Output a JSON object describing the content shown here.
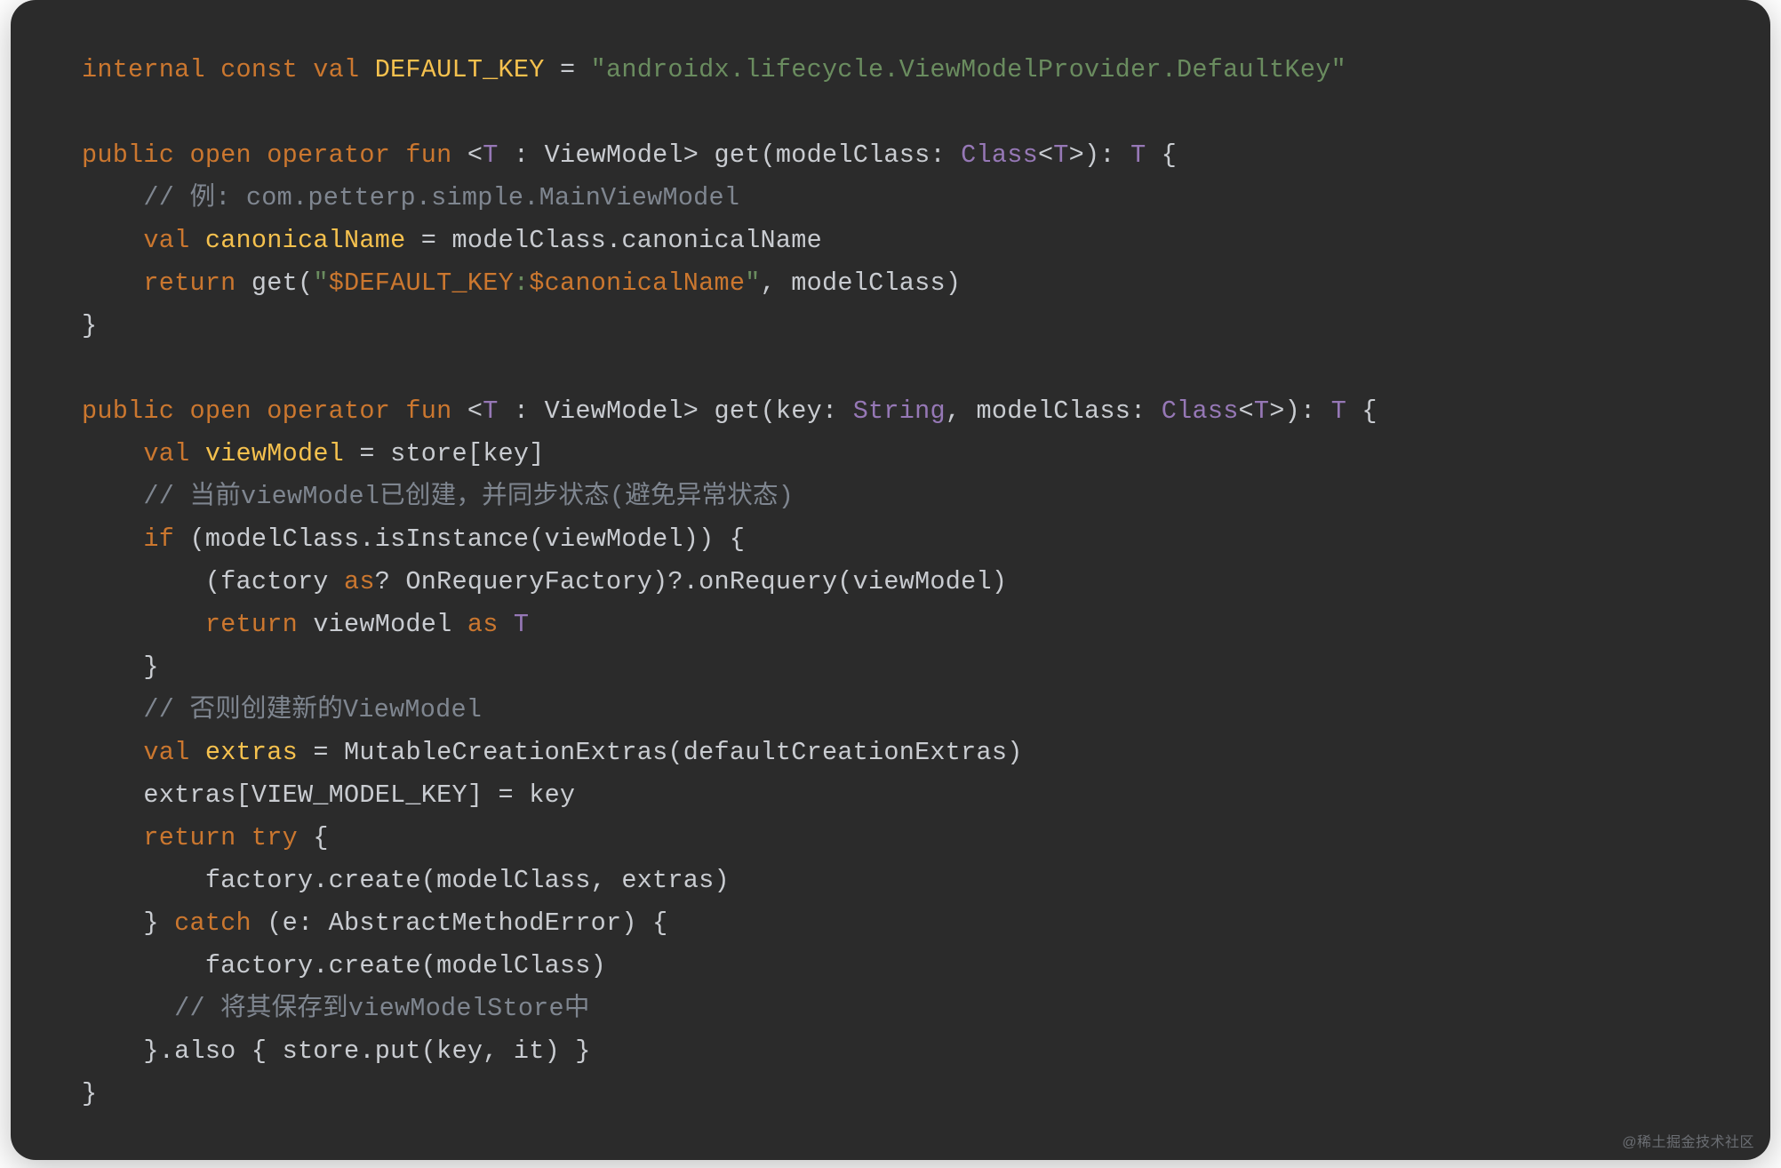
{
  "colors": {
    "bg": "#2b2b2b",
    "keyword": "#cb772f",
    "name": "#f5c14e",
    "string": "#6a8c5f",
    "comment": "#7f8690",
    "type": "#9678b6",
    "default": "#c9ccd1"
  },
  "watermark": "@稀土掘金技术社区",
  "code": {
    "lines": [
      [
        {
          "t": "internal const val ",
          "c": "kw"
        },
        {
          "t": "DEFAULT_KEY",
          "c": "name"
        },
        {
          "t": " = ",
          "c": "punc"
        },
        {
          "t": "\"androidx.lifecycle.ViewModelProvider.DefaultKey\"",
          "c": "str"
        }
      ],
      [],
      [
        {
          "t": "public open operator fun ",
          "c": "kw"
        },
        {
          "t": "<",
          "c": "punc"
        },
        {
          "t": "T",
          "c": "type"
        },
        {
          "t": " : ",
          "c": "punc"
        },
        {
          "t": "ViewModel",
          "c": "fn"
        },
        {
          "t": "> ",
          "c": "punc"
        },
        {
          "t": "get",
          "c": "fn"
        },
        {
          "t": "(modelClass: ",
          "c": "punc"
        },
        {
          "t": "Class",
          "c": "type"
        },
        {
          "t": "<",
          "c": "punc"
        },
        {
          "t": "T",
          "c": "type"
        },
        {
          "t": ">): ",
          "c": "punc"
        },
        {
          "t": "T",
          "c": "type"
        },
        {
          "t": " {",
          "c": "punc"
        }
      ],
      [
        {
          "t": "    ",
          "c": "punc"
        },
        {
          "t": "// 例: com.petterp.simple.MainViewModel",
          "c": "cmt"
        }
      ],
      [
        {
          "t": "    ",
          "c": "punc"
        },
        {
          "t": "val ",
          "c": "kw"
        },
        {
          "t": "canonicalName",
          "c": "name"
        },
        {
          "t": " = modelClass.canonicalName",
          "c": "punc"
        }
      ],
      [
        {
          "t": "    ",
          "c": "punc"
        },
        {
          "t": "return ",
          "c": "kw"
        },
        {
          "t": "get(",
          "c": "punc"
        },
        {
          "t": "\"",
          "c": "str"
        },
        {
          "t": "$DEFAULT_KEY",
          "c": "kw"
        },
        {
          "t": ":",
          "c": "str"
        },
        {
          "t": "$canonicalName",
          "c": "kw"
        },
        {
          "t": "\"",
          "c": "str"
        },
        {
          "t": ", modelClass)",
          "c": "punc"
        }
      ],
      [
        {
          "t": "}",
          "c": "punc"
        }
      ],
      [],
      [
        {
          "t": "public open operator fun ",
          "c": "kw"
        },
        {
          "t": "<",
          "c": "punc"
        },
        {
          "t": "T",
          "c": "type"
        },
        {
          "t": " : ",
          "c": "punc"
        },
        {
          "t": "ViewModel",
          "c": "fn"
        },
        {
          "t": "> ",
          "c": "punc"
        },
        {
          "t": "get",
          "c": "fn"
        },
        {
          "t": "(key: ",
          "c": "punc"
        },
        {
          "t": "String",
          "c": "type"
        },
        {
          "t": ", modelClass: ",
          "c": "punc"
        },
        {
          "t": "Class",
          "c": "type"
        },
        {
          "t": "<",
          "c": "punc"
        },
        {
          "t": "T",
          "c": "type"
        },
        {
          "t": ">): ",
          "c": "punc"
        },
        {
          "t": "T",
          "c": "type"
        },
        {
          "t": " {",
          "c": "punc"
        }
      ],
      [
        {
          "t": "    ",
          "c": "punc"
        },
        {
          "t": "val ",
          "c": "kw"
        },
        {
          "t": "viewModel",
          "c": "name"
        },
        {
          "t": " = store[key]",
          "c": "punc"
        }
      ],
      [
        {
          "t": "    ",
          "c": "punc"
        },
        {
          "t": "// 当前viewModel已创建，并同步状态(避免异常状态)",
          "c": "cmt"
        }
      ],
      [
        {
          "t": "    ",
          "c": "punc"
        },
        {
          "t": "if ",
          "c": "kw"
        },
        {
          "t": "(modelClass.isInstance(viewModel)) {",
          "c": "punc"
        }
      ],
      [
        {
          "t": "        (factory ",
          "c": "punc"
        },
        {
          "t": "as",
          "c": "kw"
        },
        {
          "t": "? OnRequeryFactory)?.onRequery(viewModel)",
          "c": "punc"
        }
      ],
      [
        {
          "t": "        ",
          "c": "punc"
        },
        {
          "t": "return ",
          "c": "kw"
        },
        {
          "t": "viewModel ",
          "c": "punc"
        },
        {
          "t": "as ",
          "c": "kw"
        },
        {
          "t": "T",
          "c": "type"
        }
      ],
      [
        {
          "t": "    }",
          "c": "punc"
        }
      ],
      [
        {
          "t": "    ",
          "c": "punc"
        },
        {
          "t": "// 否则创建新的ViewModel",
          "c": "cmt"
        }
      ],
      [
        {
          "t": "    ",
          "c": "punc"
        },
        {
          "t": "val ",
          "c": "kw"
        },
        {
          "t": "extras",
          "c": "name"
        },
        {
          "t": " = MutableCreationExtras(defaultCreationExtras)",
          "c": "punc"
        }
      ],
      [
        {
          "t": "    extras[VIEW_MODEL_KEY] = key",
          "c": "punc"
        }
      ],
      [
        {
          "t": "    ",
          "c": "punc"
        },
        {
          "t": "return try ",
          "c": "kw"
        },
        {
          "t": "{",
          "c": "punc"
        }
      ],
      [
        {
          "t": "        factory.create(modelClass, extras)",
          "c": "punc"
        }
      ],
      [
        {
          "t": "    } ",
          "c": "punc"
        },
        {
          "t": "catch ",
          "c": "kw"
        },
        {
          "t": "(e: AbstractMethodError) {",
          "c": "punc"
        }
      ],
      [
        {
          "t": "        factory.create(modelClass)",
          "c": "punc"
        }
      ],
      [
        {
          "t": "      ",
          "c": "punc"
        },
        {
          "t": "// 将其保存到viewModelStore中",
          "c": "cmt"
        }
      ],
      [
        {
          "t": "    }.also { store.put(key, it) }",
          "c": "punc"
        }
      ],
      [
        {
          "t": "}",
          "c": "punc"
        }
      ]
    ]
  }
}
